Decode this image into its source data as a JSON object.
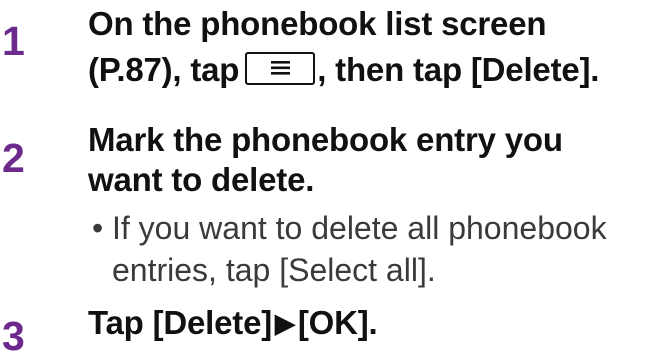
{
  "colors": {
    "step_number": "#6b2a8c",
    "heading_text": "#111111",
    "note_text": "#3a3a3a"
  },
  "steps": [
    {
      "number": "1",
      "line1": "On the phonebook list screen",
      "line2_before_icon": "(P.87), tap",
      "icon": "menu-key-icon",
      "line2_after_icon": ", then tap [Delete]."
    },
    {
      "number": "2",
      "line1": "Mark the phonebook entry you",
      "line2": "want to delete.",
      "note": {
        "bullet": "•",
        "line1": "If you want to delete all phonebook",
        "line2": "entries, tap [Select all]."
      }
    },
    {
      "number": "3",
      "before_arrow": "Tap [Delete]",
      "arrow": "▶",
      "after_arrow": "[OK]."
    }
  ]
}
